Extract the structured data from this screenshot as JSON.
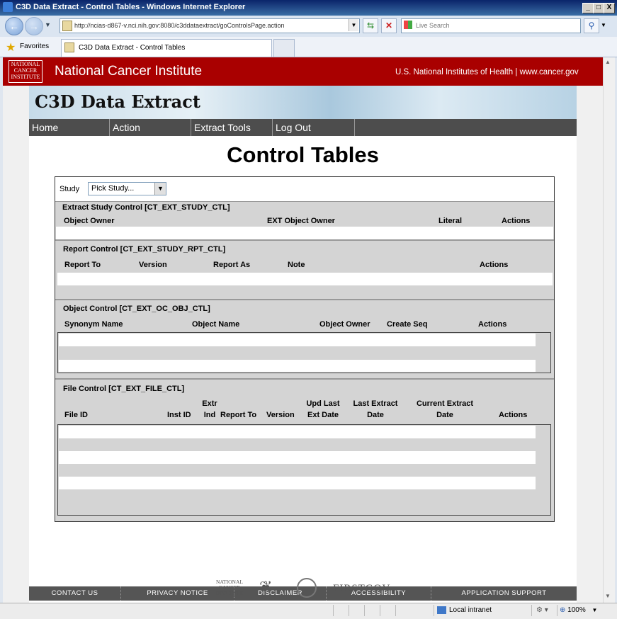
{
  "window": {
    "title": "C3D Data Extract - Control Tables - Windows Internet Explorer",
    "minimize": "_",
    "maximize": "□",
    "close": "X"
  },
  "browser": {
    "address": "http://ncias-d867-v.nci.nih.gov:8080/c3ddataextract/goControlsPage.action",
    "search_placeholder": "Live Search",
    "favorites": "Favorites",
    "tab_title": "C3D Data Extract - Control Tables"
  },
  "header": {
    "logo": "NATIONAL CANCER INSTITUTE",
    "org_name": "National Cancer Institute",
    "links": "U.S. National Institutes of Health  |  www.cancer.gov"
  },
  "app": {
    "title": "C3D Data Extract"
  },
  "menu": [
    "Home",
    "Action",
    "Extract Tools",
    "Log Out"
  ],
  "page_title": "Control Tables",
  "study": {
    "label": "Study",
    "selected": "Pick Study..."
  },
  "sections": {
    "extract_study": {
      "title": "Extract Study Control [CT_EXT_STUDY_CTL]",
      "columns": [
        "Object Owner",
        "EXT Object Owner",
        "Literal",
        "Actions"
      ]
    },
    "report": {
      "title": "Report Control [CT_EXT_STUDY_RPT_CTL]",
      "columns": [
        "Report To",
        "Version",
        "Report As",
        "Note",
        "Actions"
      ]
    },
    "object": {
      "title": "Object Control [CT_EXT_OC_OBJ_CTL]",
      "columns": [
        "Synonym Name",
        "Object Name",
        "Object Owner",
        "Create Seq",
        "Actions"
      ]
    },
    "file": {
      "title": "File Control [CT_EXT_FILE_CTL]",
      "columns": {
        "file_id": "File ID",
        "inst_id": "Inst ID",
        "extr_ind_1": "Extr",
        "extr_ind_2": "Ind",
        "report_to": "Report To",
        "version": "Version",
        "upd_1": "Upd Last",
        "upd_2": "Ext Date",
        "last_1": "Last Extract",
        "last_2": "Date",
        "cur_1": "Current Extract",
        "cur_2": "Date",
        "actions": "Actions"
      }
    }
  },
  "footer": [
    "CONTACT US",
    "PRIVACY NOTICE",
    "DISCLAIMER",
    "ACCESSIBILITY",
    "APPLICATION SUPPORT"
  ],
  "footer_logos": {
    "nci": "NATIONAL CANCER INSTITUTE",
    "firstgov": "FIRSTGOV"
  },
  "status": {
    "zone": "Local intranet",
    "zoom": "100%"
  }
}
